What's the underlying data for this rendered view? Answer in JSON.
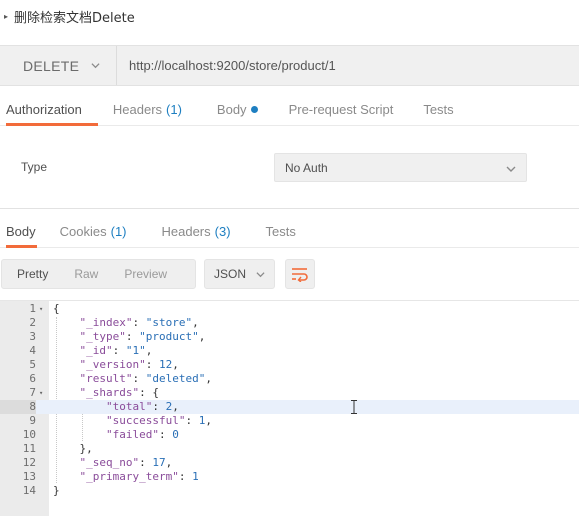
{
  "title": {
    "caret": "▸",
    "text": "删除检索文档Delete"
  },
  "request": {
    "method": "DELETE",
    "url": "http://localhost:9200/store/product/1"
  },
  "request_tabs": [
    {
      "label": "Authorization",
      "count": "",
      "dot": false,
      "active": true
    },
    {
      "label": "Headers",
      "count": "(1)",
      "dot": false,
      "active": false
    },
    {
      "label": "Body",
      "count": "",
      "dot": true,
      "active": false
    },
    {
      "label": "Pre-request Script",
      "count": "",
      "dot": false,
      "active": false
    },
    {
      "label": "Tests",
      "count": "",
      "dot": false,
      "active": false
    }
  ],
  "auth": {
    "type_label": "Type",
    "type_value": "No Auth"
  },
  "response_tabs": [
    {
      "label": "Body",
      "count": "",
      "active": true
    },
    {
      "label": "Cookies",
      "count": "(1)",
      "active": false
    },
    {
      "label": "Headers",
      "count": "(3)",
      "active": false
    },
    {
      "label": "Tests",
      "count": "",
      "active": false
    }
  ],
  "view_modes": [
    "Pretty",
    "Raw",
    "Preview"
  ],
  "format": "JSON",
  "icons": {
    "wrap": "wrap-lines-icon",
    "accent": "#f26b3a",
    "link": "#1e7fc1"
  },
  "response_body": [
    "{",
    "    \"_index\": \"store\",",
    "    \"_type\": \"product\",",
    "    \"_id\": \"1\",",
    "    \"_version\": 12,",
    "    \"result\": \"deleted\",",
    "    \"_shards\": {",
    "        \"total\": 2,",
    "        \"successful\": 1,",
    "        \"failed\": 0",
    "    },",
    "    \"_seq_no\": 17,",
    "    \"_primary_term\": 1",
    "}"
  ],
  "folds": [
    1,
    7
  ],
  "highlighted_line": 8
}
